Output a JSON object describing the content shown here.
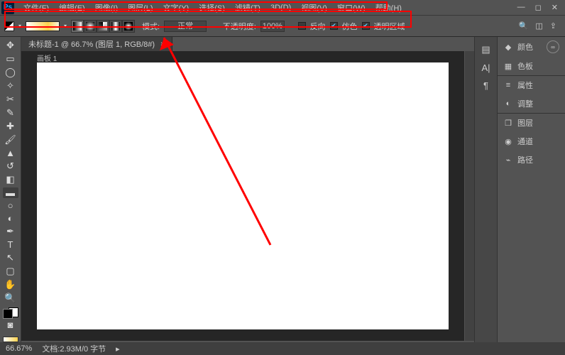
{
  "menu": {
    "items": [
      "文件(F)",
      "编辑(E)",
      "图像(I)",
      "图层(L)",
      "文字(Y)",
      "选择(S)",
      "滤镜(T)",
      "3D(D)",
      "视图(V)",
      "窗口(W)",
      "帮助(H)"
    ]
  },
  "options": {
    "mode_label": "模式:",
    "mode_value": "正常",
    "opacity_label": "不透明度:",
    "opacity_value": "100%",
    "reverse": "反向",
    "dither": "仿色",
    "transparent": "透明区域"
  },
  "tab": {
    "title": "未标题-1 @ 66.7% (图层 1, RGB/8#)"
  },
  "artboard": {
    "label": "画板 1"
  },
  "panels": {
    "color": "颜色",
    "swatches": "色板",
    "properties": "属性",
    "adjust": "调整",
    "layers": "图层",
    "channels": "通道",
    "paths": "路径"
  },
  "status": {
    "zoom": "66.67%",
    "doc": "文档:2.93M/0 字节"
  }
}
